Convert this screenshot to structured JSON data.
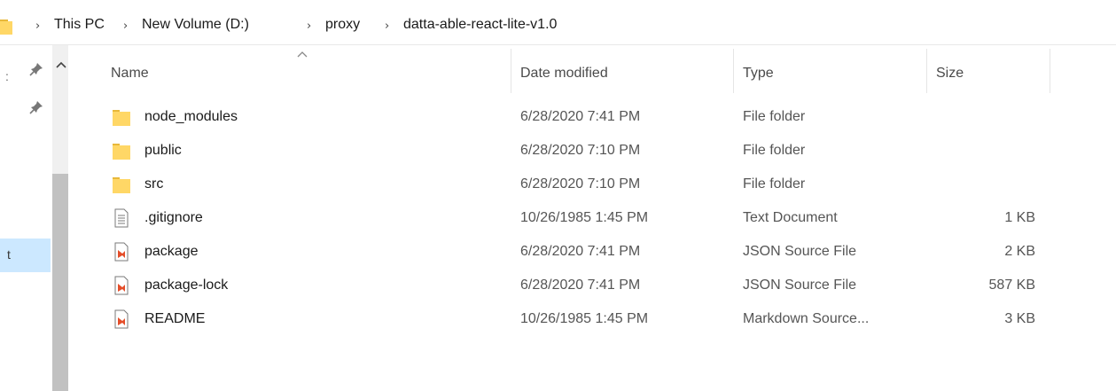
{
  "breadcrumb": {
    "items": [
      "This PC",
      "New Volume (D:)",
      "proxy",
      "datta-able-react-lite-v1.0"
    ],
    "separator": "›"
  },
  "nav": {
    "selected_label": "t"
  },
  "columns": {
    "name": "Name",
    "date": "Date modified",
    "type": "Type",
    "size": "Size"
  },
  "files": [
    {
      "name": "node_modules",
      "date": "6/28/2020 7:41 PM",
      "type": "File folder",
      "size": "",
      "icon": "folder-icon"
    },
    {
      "name": "public",
      "date": "6/28/2020 7:10 PM",
      "type": "File folder",
      "size": "",
      "icon": "folder-icon"
    },
    {
      "name": "src",
      "date": "6/28/2020 7:10 PM",
      "type": "File folder",
      "size": "",
      "icon": "folder-icon"
    },
    {
      "name": ".gitignore",
      "date": "10/26/1985 1:45 PM",
      "type": "Text Document",
      "size": "1 KB",
      "icon": "text-file-icon"
    },
    {
      "name": "package",
      "date": "6/28/2020 7:41 PM",
      "type": "JSON Source File",
      "size": "2 KB",
      "icon": "vscode-file-icon"
    },
    {
      "name": "package-lock",
      "date": "6/28/2020 7:41 PM",
      "type": "JSON Source File",
      "size": "587 KB",
      "icon": "vscode-file-icon"
    },
    {
      "name": "README",
      "date": "10/26/1985 1:45 PM",
      "type": "Markdown Source...",
      "size": "3 KB",
      "icon": "vscode-file-icon"
    }
  ],
  "colors": {
    "folder": "#ffd766",
    "vscode": "#e44e2a",
    "selection": "#cce8ff"
  }
}
